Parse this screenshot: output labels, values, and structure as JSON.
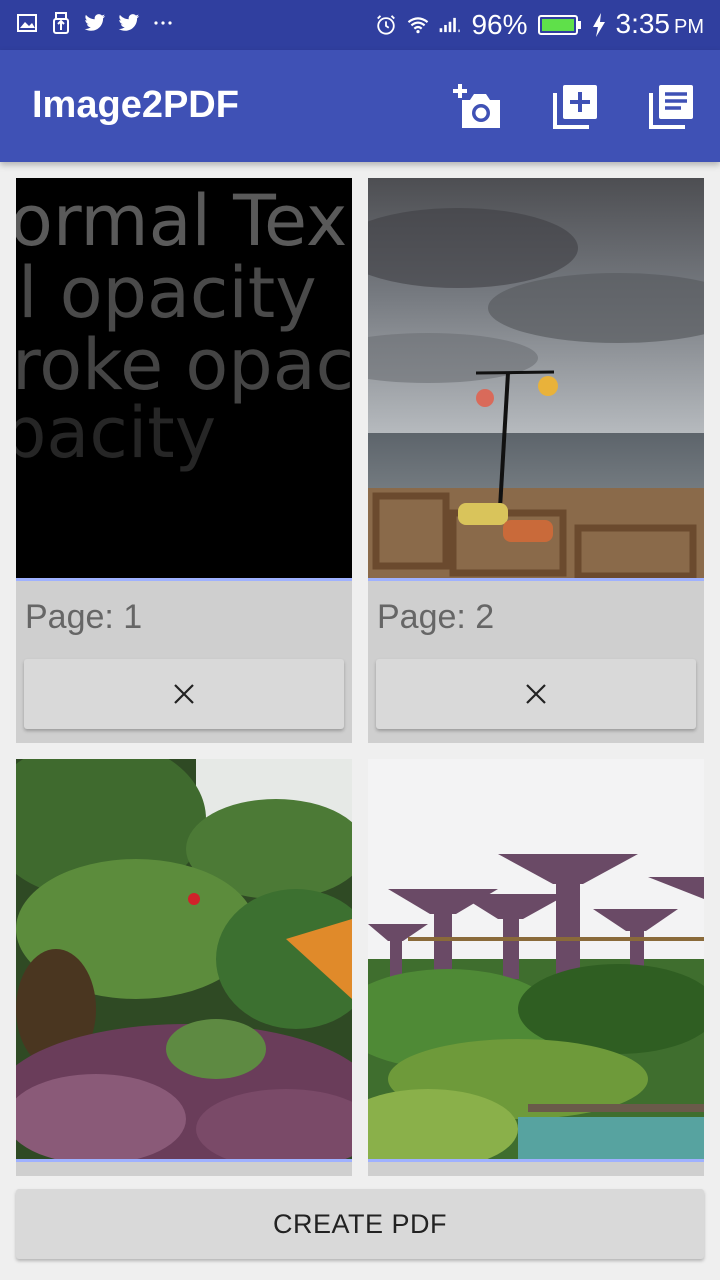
{
  "status_bar": {
    "battery": "96%",
    "time": "3:35",
    "ampm": "PM",
    "left_icons": [
      "gallery-icon",
      "usb-icon",
      "twitter-icon",
      "twitter-icon",
      "more-dots-icon"
    ],
    "right_icons": [
      "alarm-icon",
      "wifi-icon",
      "signal-icon",
      "battery-icon",
      "charging-icon"
    ]
  },
  "app_bar": {
    "title": "Image2PDF",
    "actions": [
      "add-photo-camera-icon",
      "add-to-photos-icon",
      "library-books-icon"
    ],
    "color": "#3f51b5",
    "status_color": "#303f9f"
  },
  "pages": [
    {
      "label": "Page: 1",
      "thumb_lines": [
        "ormal Tex",
        "l opacity",
        "roke opac",
        "pacity"
      ],
      "remove_icon": "close-icon"
    },
    {
      "label": "Page: 2",
      "remove_icon": "close-icon"
    },
    {},
    {}
  ],
  "footer": {
    "create_label": "CREATE PDF"
  }
}
